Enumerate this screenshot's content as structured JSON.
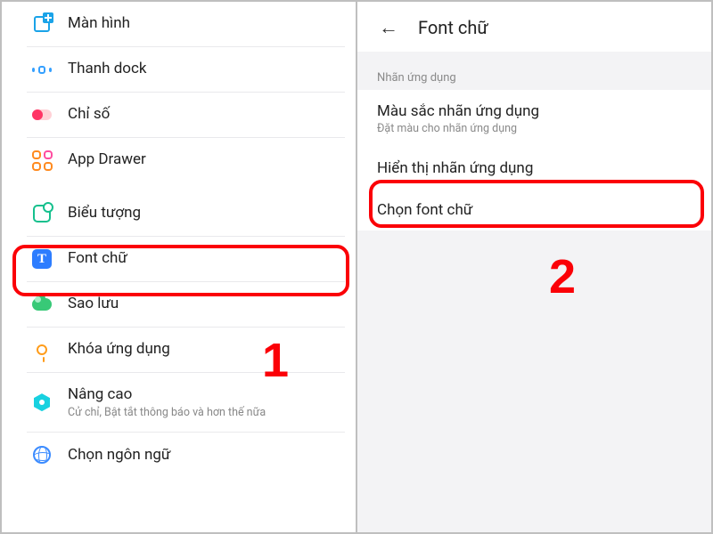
{
  "steps": {
    "one": "1",
    "two": "2"
  },
  "left": {
    "items": [
      {
        "label": "Màn hình"
      },
      {
        "label": "Thanh dock"
      },
      {
        "label": "Chỉ số"
      },
      {
        "label": "App Drawer"
      },
      {
        "label": "Biểu tượng"
      },
      {
        "label": "Font chữ"
      },
      {
        "label": "Sao lưu"
      },
      {
        "label": "Khóa ứng dụng"
      },
      {
        "label": "Nâng cao",
        "sub": "Cử chỉ, Bật tắt thông báo và hơn thế nữa"
      },
      {
        "label": "Chọn ngôn ngữ"
      }
    ]
  },
  "right": {
    "back_glyph": "←",
    "title": "Font chữ",
    "section_label": "Nhãn ứng dụng",
    "rows": [
      {
        "title": "Màu sắc nhãn ứng dụng",
        "sub": "Đặt màu cho nhãn ứng dụng"
      },
      {
        "title": "Hiển thị nhãn ứng dụng"
      },
      {
        "title": "Chọn font chữ"
      }
    ]
  },
  "icons": {
    "font_letter": "T"
  }
}
